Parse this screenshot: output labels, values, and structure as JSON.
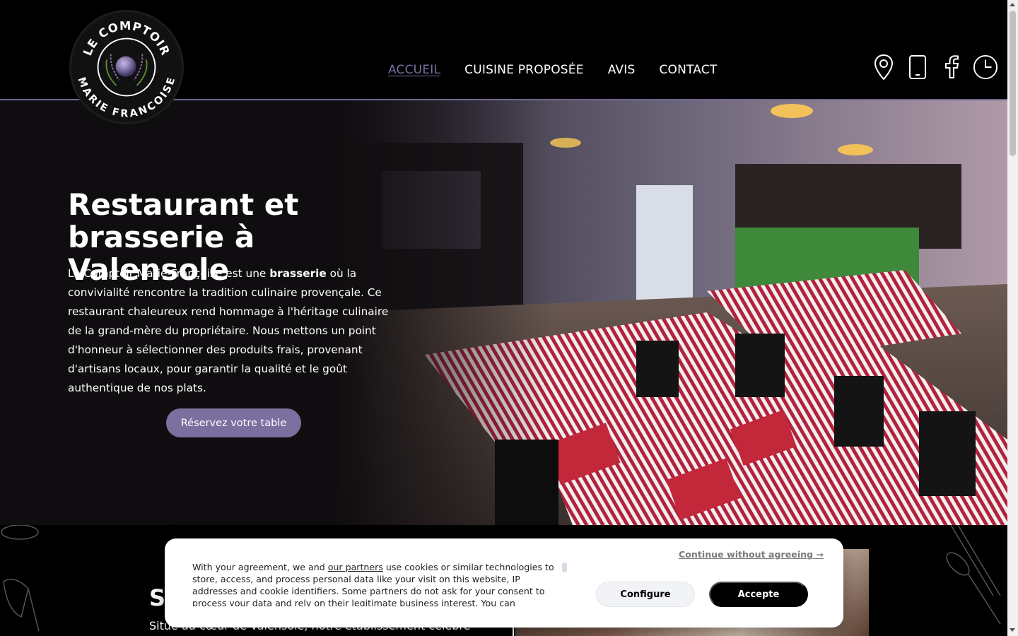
{
  "header": {
    "logo_text_top": "LE COMPTOIR",
    "logo_text_bottom": "MARIE FRANCOISE",
    "nav": [
      {
        "label": "ACCUEIL",
        "active": true
      },
      {
        "label": "CUISINE PROPOSÉE",
        "active": false
      },
      {
        "label": "AVIS",
        "active": false
      },
      {
        "label": "CONTACT",
        "active": false
      }
    ],
    "icons": [
      "map-pin-icon",
      "phone-icon",
      "facebook-icon",
      "clock-icon"
    ]
  },
  "hero": {
    "title_line1": "Restaurant et",
    "title_line2": "brasserie à Valensole",
    "text_before": "Le Comptoir Marie-Françoise est une ",
    "text_bold": "brasserie",
    "text_after": " où la convivialité rencontre la tradition culinaire provençale. Ce restaurant chaleureux rend hommage à l'héritage culinaire de la grand-mère du propriétaire. Nous mettons un point d'honneur à sélectionner des produits frais, provenant d'artisans locaux, pour garantir la qualité et le goût authentique de nos plats.",
    "cta_label": "Réservez votre table"
  },
  "section": {
    "title_partial": "Sa",
    "text_partial": "Situé au cœur de Valensole, notre établissement célèbre"
  },
  "cookie_banner": {
    "text_prefix": "With your agreement, we and ",
    "partners_link": "our partners",
    "text_rest": " use cookies or similar technologies to store, access, and process personal data like your visit on this website, IP addresses and cookie identifiers. Some partners do not ask for your consent to process your data and rely on their legitimate business interest. You can",
    "continue_label": "Continue without agreeing →",
    "configure_label": "Configure",
    "accept_label": "Accepte"
  },
  "colors": {
    "accent": "#7c6fa0",
    "background": "#000000"
  }
}
